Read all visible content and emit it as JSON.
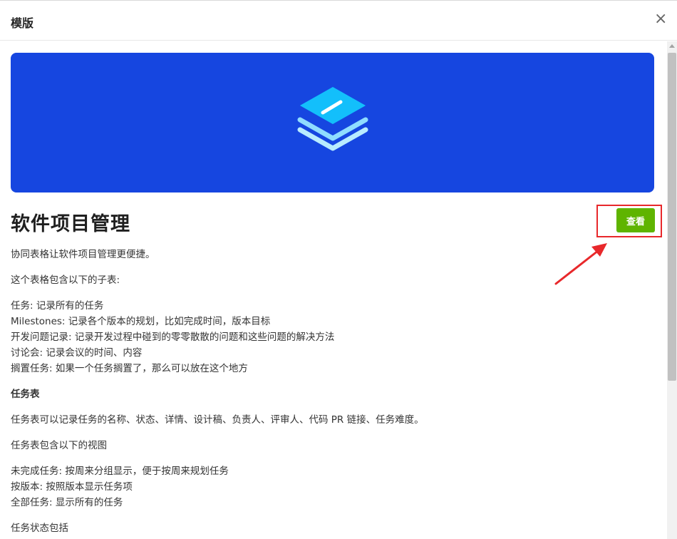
{
  "dialog": {
    "title": "模版",
    "close_symbol": "×"
  },
  "template": {
    "title": "软件项目管理",
    "view_button": "查看",
    "intro": "协同表格让软件项目管理更便捷。",
    "contains": "这个表格包含以下的子表:",
    "subtables": [
      "任务: 记录所有的任务",
      "Milestones: 记录各个版本的规划，比如完成时间，版本目标",
      "开发问题记录: 记录开发过程中碰到的零零散散的问题和这些问题的解决方法",
      "讨论会: 记录会议的时间、内容",
      "搁置任务: 如果一个任务搁置了，那么可以放在这个地方"
    ],
    "task_section_heading": "任务表",
    "task_desc": "任务表可以记录任务的名称、状态、详情、设计稿、负责人、评审人、代码 PR 链接、任务难度。",
    "task_views_heading": "任务表包含以下的视图",
    "task_views": [
      "未完成任务: 按周来分组显示，便于按周来规划任务",
      "按版本: 按照版本显示任务项",
      "全部任务: 显示所有的任务"
    ],
    "task_status_heading": "任务状态包括"
  },
  "colors": {
    "banner": "#1646e0",
    "button": "#5fb400",
    "annotation": "#e8282b"
  },
  "icons": {
    "banner_icon": "stacked-layers-icon",
    "close": "close-icon",
    "annotation": "red-arrow"
  }
}
